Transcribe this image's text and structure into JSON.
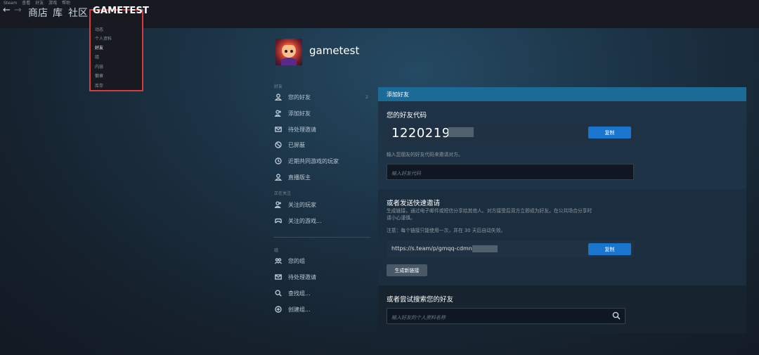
{
  "menubar": {
    "items": [
      "Steam",
      "查看",
      "好友",
      "游戏",
      "帮助"
    ]
  },
  "nav": {
    "back": "←",
    "forward": "→",
    "links": [
      "商店",
      "库",
      "社区"
    ],
    "user": "GAMETEST"
  },
  "dropdown": {
    "items": [
      "动态",
      "个人资料",
      "好友",
      "组",
      "内容",
      "徽章",
      "库存"
    ],
    "selected_index": 2
  },
  "profile": {
    "name": "gametest"
  },
  "sidebar": {
    "friends_header": "好友",
    "friends_items": [
      {
        "label": "您的好友",
        "icon": "person-icon",
        "count": "2"
      },
      {
        "label": "添加好友",
        "icon": "add-person-icon"
      },
      {
        "label": "待处理邀请",
        "icon": "envelope-icon"
      },
      {
        "label": "已屏蔽",
        "icon": "block-icon"
      },
      {
        "label": "近期共同游戏的玩家",
        "icon": "clock-icon"
      },
      {
        "label": "直播版主",
        "icon": "person-icon"
      }
    ],
    "following_header": "正在关注",
    "following_items": [
      {
        "label": "关注的玩家",
        "icon": "add-person-icon"
      },
      {
        "label": "关注的游戏...",
        "icon": "gamepad-icon"
      }
    ],
    "groups_header": "组",
    "groups_items": [
      {
        "label": "您的组",
        "icon": "group-icon"
      },
      {
        "label": "待处理邀请",
        "icon": "envelope-icon"
      },
      {
        "label": "查找组...",
        "icon": "search-icon"
      },
      {
        "label": "创建组...",
        "icon": "plus-circle-icon"
      }
    ]
  },
  "panel": {
    "title": "添加好友",
    "code_section": {
      "heading": "您的好友代码",
      "code": "1220219",
      "copy_label": "复制",
      "hint": "输入您朋友的好友代码来邀请对方。",
      "input_placeholder": "输入好友代码"
    },
    "invite_section": {
      "heading": "或者发送快速邀请",
      "desc_line1": "生成链接，通过电子邮件或短信分享给其他人。对方接受后双方立即成为好友。在公共场合分享时",
      "desc_line2": "请小心谨慎。",
      "note": "注意：每个链接只能使用一次，并在 30 天后自动失效。",
      "link": "https://s.team/p/gmqq-cdmn/",
      "copy_label": "复制",
      "new_link_label": "生成新链接"
    },
    "search_section": {
      "heading": "或者尝试搜索您的好友",
      "input_placeholder": "输入好友的个人资料名称"
    }
  },
  "colors": {
    "accent_blue": "#1a75ce",
    "header_blue": "#1b6b96",
    "highlight_border": "#d93a3a"
  }
}
